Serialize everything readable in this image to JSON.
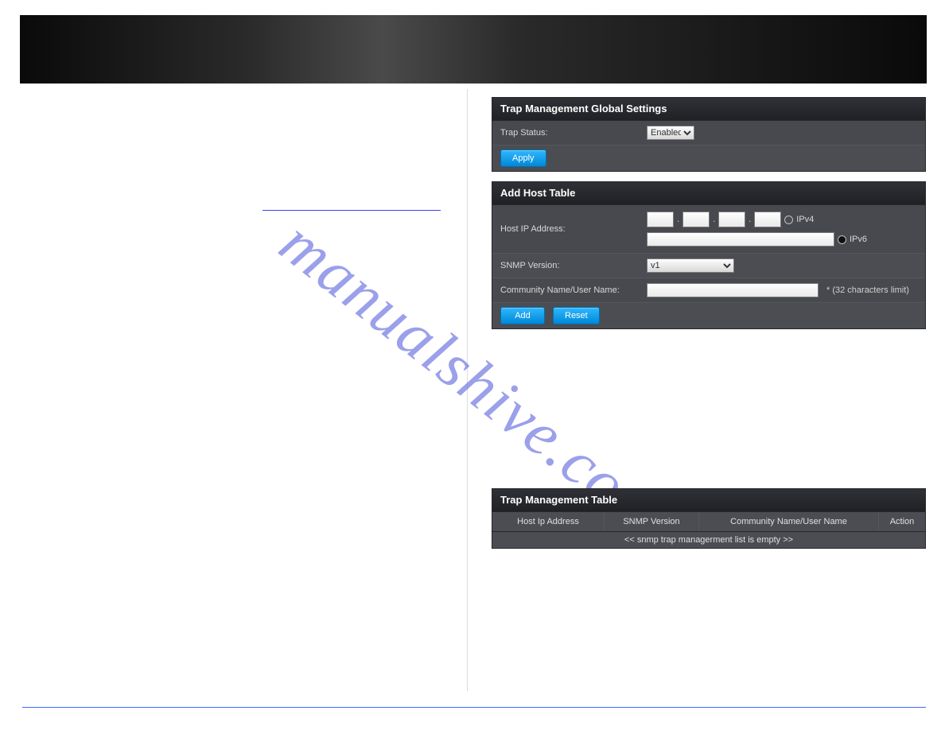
{
  "watermark": "manualshive.com",
  "global": {
    "title": "Trap Management Global Settings",
    "trap_status_label": "Trap Status:",
    "trap_status_value": "Enabled",
    "apply_label": "Apply"
  },
  "addhost": {
    "title": "Add Host Table",
    "host_ip_label": "Host IP Address:",
    "ipv4_label": "IPv4",
    "ipv6_label": "IPv6",
    "snmp_version_label": "SNMP Version:",
    "snmp_version_value": "v1",
    "community_label": "Community Name/User Name:",
    "limit_text": "* (32 characters limit)",
    "add_label": "Add",
    "reset_label": "Reset"
  },
  "table": {
    "title": "Trap Management Table",
    "cols": {
      "host": "Host Ip Address",
      "ver": "SNMP Version",
      "comm": "Community Name/User Name",
      "action": "Action"
    },
    "empty": "<< snmp trap managerment list is empty >>"
  }
}
